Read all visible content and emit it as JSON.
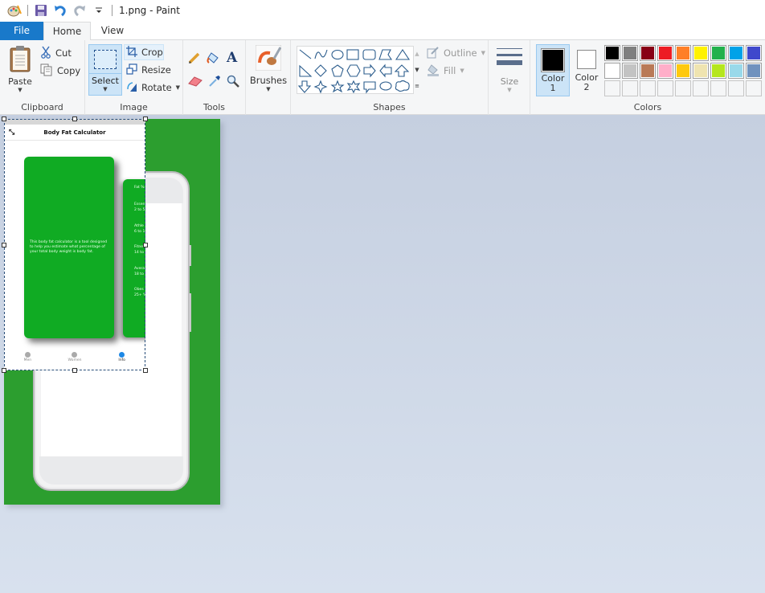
{
  "window": {
    "title": "1.png - Paint"
  },
  "quick_access": [
    {
      "name": "paint-app-icon"
    },
    {
      "name": "save-icon"
    },
    {
      "name": "undo-icon"
    },
    {
      "name": "redo-icon"
    },
    {
      "name": "customize-quick-access-icon"
    }
  ],
  "tabs": [
    {
      "label": "File",
      "active": false
    },
    {
      "label": "Home",
      "active": true
    },
    {
      "label": "View",
      "active": false
    }
  ],
  "ribbon": {
    "clipboard": {
      "label": "Clipboard",
      "paste": "Paste",
      "cut": "Cut",
      "copy": "Copy"
    },
    "image": {
      "label": "Image",
      "select": "Select",
      "crop": "Crop",
      "resize": "Resize",
      "rotate": "Rotate"
    },
    "tools": {
      "label": "Tools",
      "items": [
        "pencil",
        "fill",
        "text",
        "eraser",
        "color-picker",
        "magnifier"
      ]
    },
    "brushes": {
      "label": "Brushes"
    },
    "shapes": {
      "label": "Shapes",
      "outline": "Outline",
      "fill": "Fill",
      "items": [
        "line",
        "curve",
        "oval",
        "rectangle",
        "rounded-rectangle",
        "polygon",
        "triangle",
        "right-triangle",
        "diamond",
        "pentagon",
        "hexagon",
        "right-arrow",
        "left-arrow",
        "up-arrow",
        "down-arrow",
        "four-point-star",
        "five-point-star",
        "six-point-star",
        "rounded-callout",
        "oval-callout",
        "cloud-callout"
      ]
    },
    "size": {
      "label": "Size"
    },
    "colors": {
      "label": "Colors",
      "color1_label": "Color",
      "color1_num": "1",
      "color2_label": "Color",
      "color2_num": "2",
      "color1": "#000000",
      "color2": "#ffffff",
      "palette_row1": [
        "#000000",
        "#7f7f7f",
        "#880015",
        "#ed1c24",
        "#ff7f27",
        "#fff200",
        "#22b14c",
        "#00a2e8",
        "#3f48cc"
      ],
      "palette_row2": [
        "#ffffff",
        "#c3c3c3",
        "#b97a57",
        "#ffaec9",
        "#ffc90e",
        "#efe4b0",
        "#b5e61d",
        "#99d9ea",
        "#7092be"
      ]
    }
  },
  "canvas": {
    "background": "#2c9e2f",
    "pasted_app": {
      "header_title": "Body Fat Calculator",
      "main_card_text": "This body fat calculator is a tool designed to help you estimate what percentage of your total body weight is body fat.",
      "side_card_items": [
        "Fat %",
        "Essen",
        "2 to 5",
        "Athle",
        "6 to 1",
        "Fitne",
        "14 to",
        "Avera",
        "18 to",
        "Obes",
        "25+ %"
      ],
      "nav": [
        {
          "label": "Men",
          "active": false
        },
        {
          "label": "Women",
          "active": false
        },
        {
          "label": "Info",
          "active": true
        }
      ]
    }
  }
}
